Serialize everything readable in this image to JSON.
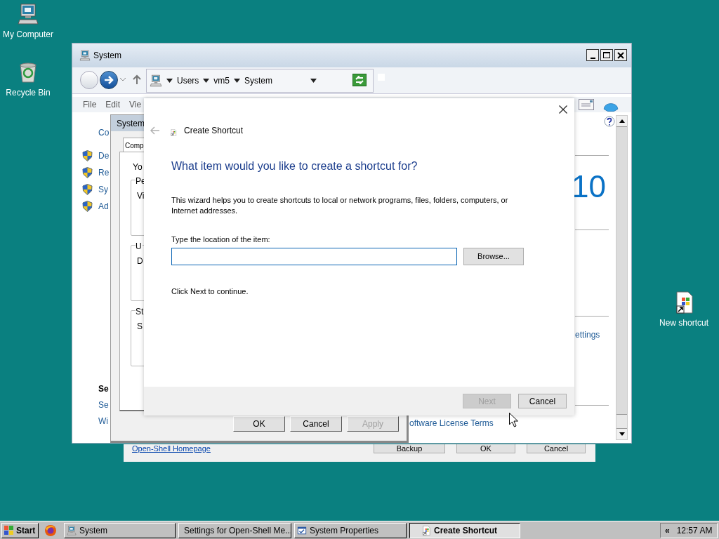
{
  "desktop_icons": [
    {
      "kind": "computer",
      "label": "My Computer"
    },
    {
      "kind": "recycle-bin",
      "label": "Recycle Bin"
    },
    {
      "kind": "shortcut",
      "label": "New shortcut"
    }
  ],
  "settings_window": {
    "link": "Open-Shell Homepage",
    "buttons": [
      "Backup",
      "OK",
      "Cancel"
    ]
  },
  "system_window": {
    "title": "System",
    "address": [
      "Users",
      "vm5",
      "System"
    ],
    "menu": [
      "File",
      "Edit",
      "Vie"
    ],
    "control_panel_link": "Co",
    "tasks": [
      "De",
      "Re",
      "Sy",
      "Ad"
    ],
    "see_also_heading": "Se",
    "see_also": [
      "Se",
      "Wi"
    ],
    "edition_number": "10",
    "settings_link": "ettings",
    "license_link": "oftware License Terms"
  },
  "system_properties": {
    "title": "System",
    "tabs": [
      {
        "label": "Comp",
        "selected": true
      }
    ],
    "intro": "Yo",
    "groups": [
      {
        "title": "Pe",
        "text": "Vi"
      },
      {
        "title": "U",
        "text": "D"
      },
      {
        "title": "St",
        "text": "S"
      }
    ],
    "buttons": [
      {
        "label": "OK",
        "disabled": false
      },
      {
        "label": "Cancel",
        "disabled": false
      },
      {
        "label": "Apply",
        "disabled": true
      }
    ]
  },
  "wizard": {
    "title": "Create Shortcut",
    "heading": "What item would you like to create a shortcut for?",
    "description": "This wizard helps you to create shortcuts to local or network programs, files, folders, computers, or Internet addresses.",
    "location_label": "Type the location of the item:",
    "browse_button": "Browse...",
    "hint": "Click Next to continue.",
    "buttons": [
      {
        "label": "Next",
        "disabled": true
      },
      {
        "label": "Cancel",
        "disabled": false
      }
    ]
  },
  "taskbar": {
    "start": "Start",
    "buttons": [
      {
        "kind": "computer",
        "label": "System",
        "selected": false
      },
      {
        "kind": "shell",
        "label": "Settings for Open-Shell Me...",
        "selected": false
      },
      {
        "kind": "properties",
        "label": "System Properties",
        "selected": false
      },
      {
        "kind": "shortcut",
        "label": "Create Shortcut",
        "selected": true
      }
    ],
    "tray_toggle": "«",
    "clock": "12:57 AM"
  }
}
